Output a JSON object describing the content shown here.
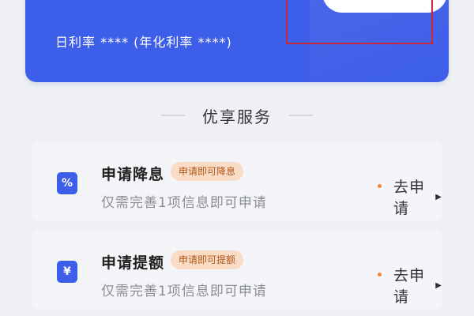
{
  "hero": {
    "masked_amount": "* * * *",
    "rate_line": "日利率 **** (年化利率 ****)"
  },
  "services": {
    "section_title": "优享服务",
    "items": [
      {
        "icon": "percent-icon",
        "icon_glyph": "%",
        "title": "申请降息",
        "badge": "申请即可降息",
        "description": "仅需完善1项信息即可申请",
        "action_label": "去申请"
      },
      {
        "icon": "yen-icon",
        "icon_glyph": "¥",
        "title": "申请提额",
        "badge": "申请即可提额",
        "description": "仅需完善1项信息即可申请",
        "action_label": "去申请"
      }
    ]
  },
  "colors": {
    "primary": "#3d5ee8",
    "badge_bg": "#f8dcc6",
    "badge_text": "#b05818",
    "accent_dot": "#f28a3c",
    "highlight": "#c8283c"
  }
}
